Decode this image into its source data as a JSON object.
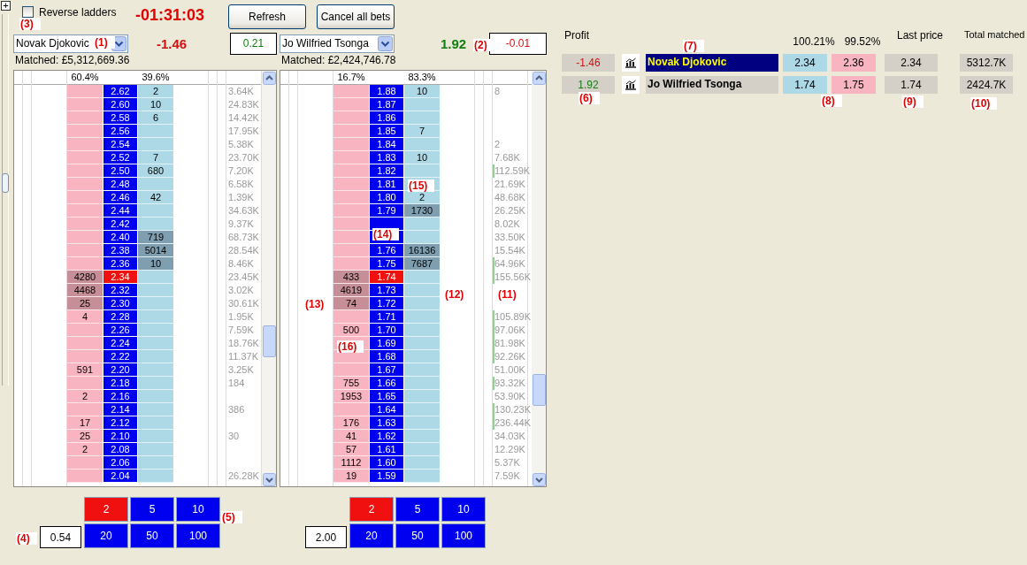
{
  "side_strip": {
    "expand_glyph": "+"
  },
  "toolbar": {
    "reverse_ladders": {
      "label": "Reverse ladders",
      "checked": false
    },
    "timer": "-01:31:03",
    "buttons": [
      "Refresh",
      "Cancel all bets"
    ]
  },
  "ladders": [
    {
      "runner": "Novak Djokovic",
      "profit": "-1.46",
      "profit_negative": true,
      "hedge": "0.21",
      "hedge_negative": false,
      "matched": "Matched: £5,312,669.36",
      "header_back": "60.4%",
      "header_lay": "39.6%",
      "rows": [
        {
          "price": "2.62",
          "lay": "2",
          "highlight": false,
          "traded": "3.64K",
          "volume_bar": false,
          "last_traded": false
        },
        {
          "price": "2.60",
          "lay": "10",
          "highlight": false,
          "traded": "24.83K",
          "volume_bar": false,
          "last_traded": false
        },
        {
          "price": "2.58",
          "lay": "6",
          "highlight": false,
          "traded": "14.42K",
          "volume_bar": false,
          "last_traded": false
        },
        {
          "price": "2.56",
          "traded": "17.95K",
          "volume_bar": false,
          "last_traded": false
        },
        {
          "price": "2.54",
          "traded": "5.38K",
          "volume_bar": false,
          "last_traded": false
        },
        {
          "price": "2.52",
          "lay": "7",
          "highlight": false,
          "traded": "23.70K",
          "volume_bar": false,
          "last_traded": false
        },
        {
          "price": "2.50",
          "lay": "680",
          "highlight": false,
          "traded": "7.20K",
          "volume_bar": false,
          "last_traded": false
        },
        {
          "price": "2.48",
          "traded": "6.58K",
          "volume_bar": false,
          "last_traded": false
        },
        {
          "price": "2.46",
          "lay": "42",
          "highlight": false,
          "traded": "1.39K",
          "volume_bar": false,
          "last_traded": false
        },
        {
          "price": "2.44",
          "traded": "34.63K",
          "volume_bar": false,
          "last_traded": false
        },
        {
          "price": "2.42",
          "traded": "9.37K",
          "volume_bar": false,
          "last_traded": false
        },
        {
          "price": "2.40",
          "lay": "719",
          "highlight": true,
          "traded": "68.73K",
          "volume_bar": false,
          "last_traded": false
        },
        {
          "price": "2.38",
          "lay": "5014",
          "highlight": true,
          "traded": "28.54K",
          "volume_bar": false,
          "last_traded": false
        },
        {
          "price": "2.36",
          "lay": "10",
          "highlight": true,
          "traded": "8.46K",
          "volume_bar": false,
          "last_traded": false
        },
        {
          "price": "2.34",
          "back": "4280",
          "highlight": true,
          "traded": "23.45K",
          "volume_bar": false,
          "last_traded": true
        },
        {
          "price": "2.32",
          "back": "4468",
          "highlight": true,
          "traded": "3.02K",
          "volume_bar": false,
          "last_traded": false
        },
        {
          "price": "2.30",
          "back": "25",
          "highlight": true,
          "traded": "30.61K",
          "volume_bar": false,
          "last_traded": false
        },
        {
          "price": "2.28",
          "back": "4",
          "highlight": false,
          "traded": "1.95K",
          "volume_bar": false,
          "last_traded": false
        },
        {
          "price": "2.26",
          "traded": "7.59K",
          "volume_bar": false,
          "last_traded": false
        },
        {
          "price": "2.24",
          "traded": "18.76K",
          "volume_bar": false,
          "last_traded": false
        },
        {
          "price": "2.22",
          "traded": "11.37K",
          "volume_bar": false,
          "last_traded": false
        },
        {
          "price": "2.20",
          "back": "591",
          "highlight": false,
          "traded": "3.25K",
          "volume_bar": false,
          "last_traded": false
        },
        {
          "price": "2.18",
          "traded": "184",
          "volume_bar": false,
          "last_traded": false
        },
        {
          "price": "2.16",
          "back": "2",
          "highlight": false,
          "last_traded": false
        },
        {
          "price": "2.14",
          "traded": "386",
          "volume_bar": false,
          "last_traded": false
        },
        {
          "price": "2.12",
          "back": "17",
          "highlight": false,
          "last_traded": false
        },
        {
          "price": "2.10",
          "back": "25",
          "highlight": false,
          "traded": "30",
          "volume_bar": false,
          "last_traded": false
        },
        {
          "price": "2.08",
          "back": "2",
          "highlight": false,
          "last_traded": false
        },
        {
          "price": "2.06",
          "last_traded": false
        },
        {
          "price": "2.04",
          "traded": "26.28K",
          "volume_bar": false,
          "last_traded": false
        }
      ],
      "stake": "0.54",
      "stake_buttons": [
        {
          "label": "2",
          "selected": true
        },
        {
          "label": "5",
          "selected": false
        },
        {
          "label": "10",
          "selected": false
        },
        {
          "label": "20",
          "selected": false
        },
        {
          "label": "50",
          "selected": false
        },
        {
          "label": "100",
          "selected": false
        }
      ]
    },
    {
      "runner": "Jo Wilfried Tsonga",
      "profit": "1.92",
      "profit_negative": false,
      "hedge": "-0.01",
      "hedge_negative": true,
      "matched": "Matched: £2,424,746.78",
      "header_back": "16.7%",
      "header_lay": "83.3%",
      "rows": [
        {
          "price": "1.88",
          "lay": "10",
          "highlight": false,
          "traded": "8",
          "volume_bar": false,
          "last_traded": false
        },
        {
          "price": "1.87",
          "last_traded": false
        },
        {
          "price": "1.86",
          "last_traded": false
        },
        {
          "price": "1.85",
          "lay": "7",
          "highlight": false,
          "last_traded": false
        },
        {
          "price": "1.84",
          "traded": "2",
          "volume_bar": false,
          "last_traded": false
        },
        {
          "price": "1.83",
          "lay": "10",
          "highlight": false,
          "traded": "7.68K",
          "volume_bar": false,
          "last_traded": false
        },
        {
          "price": "1.82",
          "traded": "112.59K",
          "volume_bar": true,
          "last_traded": false
        },
        {
          "price": "1.81",
          "traded": "21.69K",
          "volume_bar": false,
          "last_traded": false
        },
        {
          "price": "1.80",
          "lay": "2",
          "highlight": false,
          "traded": "48.68K",
          "volume_bar": false,
          "last_traded": false
        },
        {
          "price": "1.79",
          "lay": "1730",
          "highlight": true,
          "traded": "26.25K",
          "volume_bar": false,
          "last_traded": false
        },
        {
          "traded": "8.02K",
          "volume_bar": false,
          "last_traded": false
        },
        {
          "traded": "33.50K",
          "volume_bar": false,
          "last_traded": false
        },
        {
          "price": "1.76",
          "lay": "16136",
          "highlight": true,
          "traded": "15.54K",
          "volume_bar": false,
          "last_traded": false
        },
        {
          "price": "1.75",
          "lay": "7687",
          "highlight": true,
          "traded": "64.96K",
          "volume_bar": true,
          "last_traded": false
        },
        {
          "price": "1.74",
          "back": "433",
          "highlight": true,
          "traded": "155.56K",
          "volume_bar": true,
          "last_traded": true
        },
        {
          "price": "1.73",
          "back": "4619",
          "highlight": true,
          "last_traded": false
        },
        {
          "price": "1.72",
          "back": "74",
          "highlight": true,
          "last_traded": false
        },
        {
          "price": "1.71",
          "traded": "105.89K",
          "volume_bar": true,
          "last_traded": false
        },
        {
          "price": "1.70",
          "back": "500",
          "highlight": false,
          "traded": "97.06K",
          "volume_bar": true,
          "last_traded": false
        },
        {
          "price": "1.69",
          "traded": "81.98K",
          "volume_bar": true,
          "last_traded": false
        },
        {
          "price": "1.68",
          "traded": "92.26K",
          "volume_bar": true,
          "last_traded": false
        },
        {
          "price": "1.67",
          "traded": "51.00K",
          "volume_bar": false,
          "last_traded": false
        },
        {
          "price": "1.66",
          "back": "755",
          "highlight": false,
          "traded": "93.32K",
          "volume_bar": true,
          "last_traded": false
        },
        {
          "price": "1.65",
          "back": "1953",
          "highlight": false,
          "traded": "53.90K",
          "volume_bar": false,
          "last_traded": false
        },
        {
          "price": "1.64",
          "traded": "130.23K",
          "volume_bar": true,
          "last_traded": false
        },
        {
          "price": "1.63",
          "back": "176",
          "highlight": false,
          "traded": "236.44K",
          "volume_bar": true,
          "last_traded": false
        },
        {
          "price": "1.62",
          "back": "41",
          "highlight": false,
          "traded": "34.03K",
          "volume_bar": false,
          "last_traded": false
        },
        {
          "price": "1.61",
          "back": "57",
          "highlight": false,
          "traded": "12.29K",
          "volume_bar": false,
          "last_traded": false
        },
        {
          "price": "1.60",
          "back": "1112",
          "highlight": false,
          "traded": "5.37K",
          "volume_bar": false,
          "last_traded": false
        },
        {
          "price": "1.59",
          "back": "19",
          "highlight": false,
          "traded": "7.59K",
          "volume_bar": false,
          "last_traded": false
        }
      ],
      "stake": "2.00",
      "stake_buttons": [
        {
          "label": "2",
          "selected": true
        },
        {
          "label": "5",
          "selected": false
        },
        {
          "label": "10",
          "selected": false
        },
        {
          "label": "20",
          "selected": false
        },
        {
          "label": "50",
          "selected": false
        },
        {
          "label": "100",
          "selected": false
        }
      ]
    }
  ],
  "market": {
    "headers": {
      "profit": "Profit",
      "back_book": "100.21%",
      "lay_book": "99.52%",
      "last_price": "Last price",
      "total_matched": "Total matched"
    },
    "runners": [
      {
        "profit": "-1.46",
        "negative": true,
        "name": "Novak Djokovic",
        "selected": true,
        "back": "2.34",
        "lay": "2.36",
        "last_price": "2.34",
        "total_matched": "5312.7K"
      },
      {
        "profit": "1.92",
        "negative": false,
        "name": "Jo Wilfried Tsonga",
        "selected": false,
        "back": "1.74",
        "lay": "1.75",
        "last_price": "1.74",
        "total_matched": "2424.7K"
      }
    ]
  },
  "callouts": [
    "(1)",
    "(2)",
    "(3)",
    "(4)",
    "(5)",
    "(6)",
    "(7)",
    "(8)",
    "(9)",
    "(10)",
    "(11)",
    "(12)",
    "(13)",
    "(14)",
    "(15)",
    "(16)"
  ]
}
